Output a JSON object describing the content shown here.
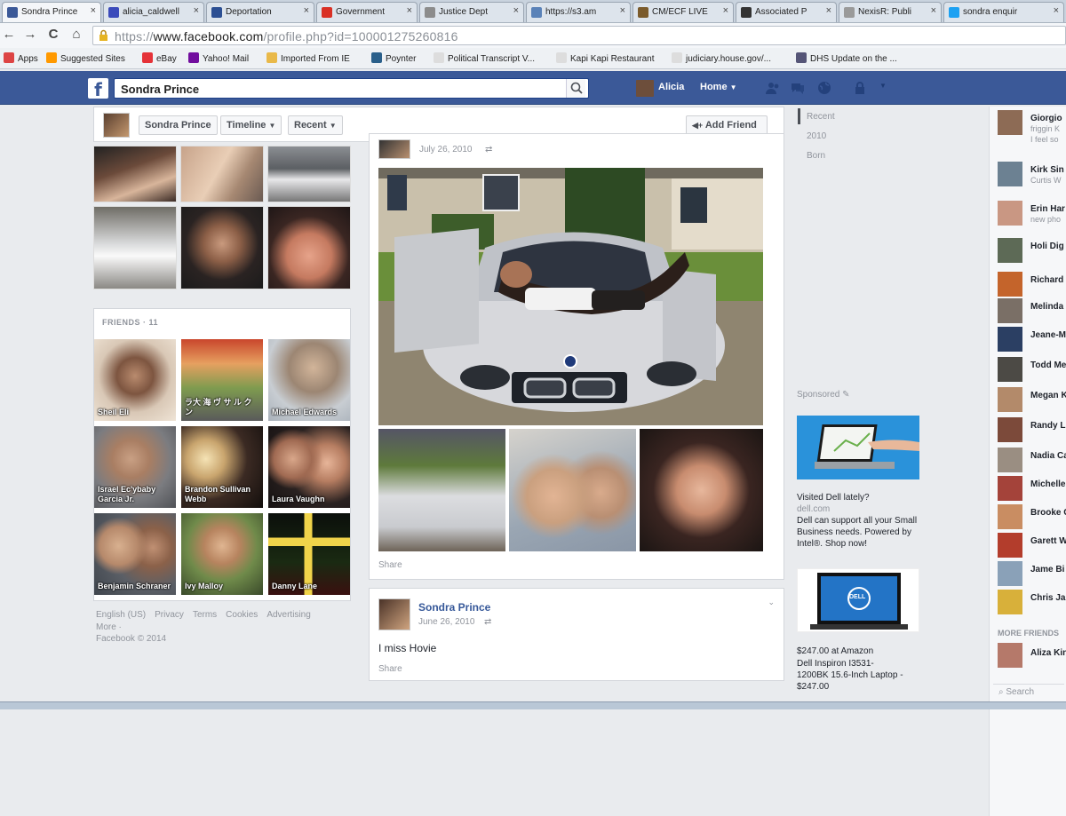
{
  "browser": {
    "tabs": [
      {
        "label": "Sondra Prince",
        "color": "#3b5998",
        "active": true
      },
      {
        "label": "alicia_caldwell",
        "color": "#3b4bbb"
      },
      {
        "label": "Deportation",
        "color": "#2c4f93"
      },
      {
        "label": "Government",
        "color": "#d93025"
      },
      {
        "label": "Justice Dept",
        "color": "#8c8c8c"
      },
      {
        "label": "https://s3.am",
        "color": "#5a82b8"
      },
      {
        "label": "CM/ECF LIVE",
        "color": "#7b5b2b"
      },
      {
        "label": "Associated P",
        "color": "#333333"
      },
      {
        "label": "NexisR: Publi",
        "color": "#9a9a9a"
      },
      {
        "label": "sondra enquir",
        "color": "#1da1f2"
      }
    ],
    "nav": {
      "back": "←",
      "forward": "→",
      "reload": "C",
      "home": "⌂"
    },
    "url": {
      "prefix": "https://",
      "host": "www.facebook.com",
      "path": "/profile.php?id=100001275260816"
    },
    "bookmarks": [
      {
        "label": "Apps",
        "color": "#d44"
      },
      {
        "label": "Suggested Sites",
        "color": "#f90"
      },
      {
        "label": "eBay",
        "color": "#e53238"
      },
      {
        "label": "Yahoo! Mail",
        "color": "#720e9e"
      },
      {
        "label": "Imported From IE",
        "color": "#e9b949"
      },
      {
        "label": "Poynter",
        "color": "#2a5f8a"
      },
      {
        "label": "Political Transcript V...",
        "color": "#ddd"
      },
      {
        "label": "Kapi Kapi Restaurant",
        "color": "#ddd"
      },
      {
        "label": "judiciary.house.gov/...",
        "color": "#ddd"
      },
      {
        "label": "DHS Update on the ...",
        "color": "#557"
      }
    ]
  },
  "fb": {
    "logo": "f",
    "search_value": "Sondra Prince",
    "user_name": "Alicia",
    "home_label": "Home",
    "profile_name": "Sondra Prince",
    "timeline_label": "Timeline",
    "recent_label": "Recent",
    "add_friend_label": "Add Friend"
  },
  "friends": {
    "title": "FRIENDS",
    "count": "11",
    "items": [
      {
        "name": "Sheil Eli"
      },
      {
        "name": "ラ大 海 ヴ サ ル ク ン"
      },
      {
        "name": "Michael Edwards"
      },
      {
        "name": "Israel Ec'ybaby Garcia Jr."
      },
      {
        "name": "Brandon Sullivan Webb"
      },
      {
        "name": "Laura Vaughn"
      },
      {
        "name": "Benjamin Schraner"
      },
      {
        "name": "Ivy Malloy"
      },
      {
        "name": "Danny Lane"
      }
    ]
  },
  "footer": {
    "links": [
      "English (US)",
      "Privacy",
      "Terms",
      "Cookies",
      "Advertising"
    ],
    "more": "More ·",
    "copyright": "Facebook © 2014"
  },
  "post1": {
    "date": "July 26, 2010",
    "share": "Share"
  },
  "post2": {
    "author": "Sondra Prince",
    "date": "June 26, 2010",
    "text": "I miss Hovie",
    "share": "Share"
  },
  "timeline_nav": [
    "Recent",
    "2010",
    "Born"
  ],
  "ads": {
    "sponsored": "Sponsored",
    "ad1_title": "Visited Dell lately?",
    "ad1_domain": "dell.com",
    "ad1_body": "Dell can support all your Small Business needs. Powered by Intel®. Shop now!",
    "ad2_title": "$247.00 at Amazon",
    "ad2_body": "Dell Inspiron I3531-1200BK 15.6-Inch Laptop - $247.00",
    "dell_logo": "DELL"
  },
  "chat": {
    "items": [
      {
        "name": "Giorgio",
        "sub": "friggin K",
        "sub2": "I feel so"
      },
      {
        "name": "Kirk Sin",
        "sub": "Curtis W"
      },
      {
        "name": "Erin Har",
        "sub": "new pho"
      },
      {
        "name": "Holi Dig"
      },
      {
        "name": "Richard"
      },
      {
        "name": "Melinda"
      },
      {
        "name": "Jeane-M"
      },
      {
        "name": "Todd Me"
      },
      {
        "name": "Megan K"
      },
      {
        "name": "Randy L"
      },
      {
        "name": "Nadia Ca"
      },
      {
        "name": "Michelle"
      },
      {
        "name": "Brooke C"
      },
      {
        "name": "Garett W"
      },
      {
        "name": "Jame Bi"
      },
      {
        "name": "Chris Ja"
      }
    ],
    "more_friends": "MORE FRIENDS",
    "extra": "Aliza Kin",
    "search": "Search"
  }
}
